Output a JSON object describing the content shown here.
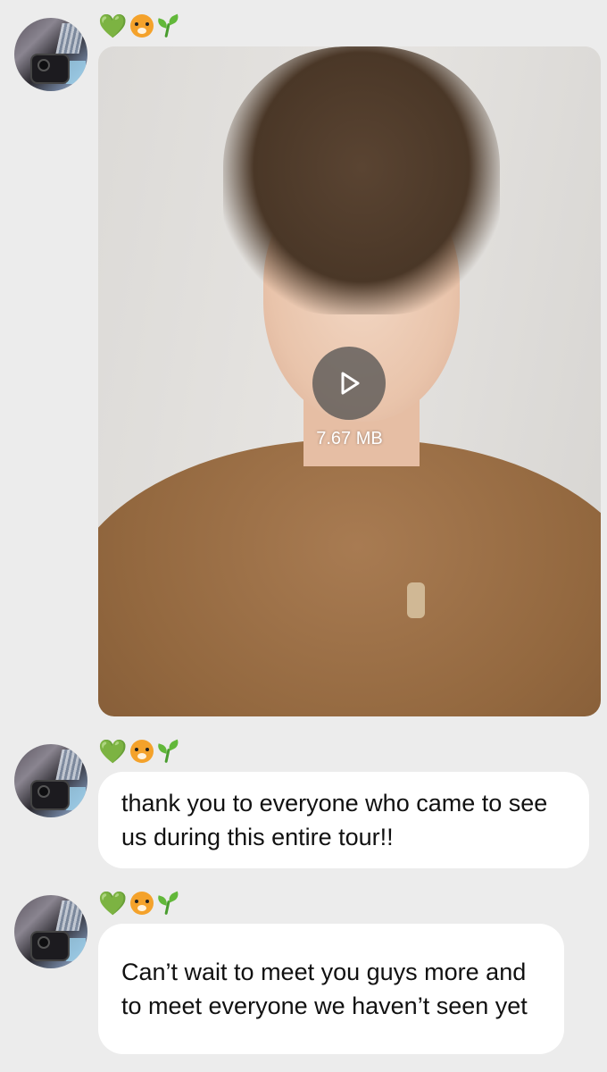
{
  "sender": {
    "name_emojis": [
      {
        "icon": "green-heart-icon",
        "glyph": "💚"
      },
      {
        "icon": "tiger-face-icon",
        "glyph": "🐯"
      },
      {
        "icon": "seedling-icon",
        "glyph": "🌱"
      }
    ]
  },
  "messages": [
    {
      "type": "video",
      "file_size": "7.67 MB"
    },
    {
      "type": "text",
      "text": "thank you to everyone who came to see us during this entire tour!!"
    },
    {
      "type": "text",
      "text": "Can’t wait to meet you guys more and to meet everyone we haven’t seen yet"
    }
  ],
  "colors": {
    "background": "#ececec",
    "bubble": "#ffffff",
    "text": "#111111",
    "play_overlay": "#505050"
  }
}
